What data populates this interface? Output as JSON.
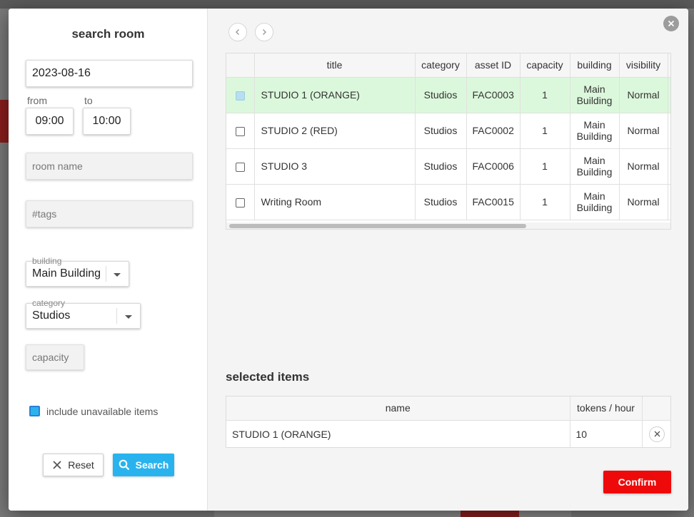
{
  "colors": {
    "accent_blue": "#29b3ee",
    "confirm_red": "#ee0a0a",
    "selected_row_green": "#dcf8dc"
  },
  "search_panel": {
    "title": "search room",
    "date": "2023-08-16",
    "from_label": "from",
    "to_label": "to",
    "from_time": "09:00",
    "to_time": "10:00",
    "room_name_placeholder": "room name",
    "tags_placeholder": "#tags",
    "building_label": "building",
    "building_value": "Main Building",
    "category_label": "category",
    "category_value": "Studios",
    "capacity_placeholder": "capacity",
    "include_unavailable_label": "include unavailable items",
    "include_unavailable_checked": true,
    "reset_label": "Reset",
    "search_label": "Search"
  },
  "results_table": {
    "columns": [
      "title",
      "category",
      "asset ID",
      "capacity",
      "building",
      "visibility"
    ],
    "rows": [
      {
        "title": "STUDIO 1 (ORANGE)",
        "category": "Studios",
        "asset_id": "FAC0003",
        "capacity": "1",
        "building": "Main Building",
        "visibility": "Normal",
        "selected": true
      },
      {
        "title": "STUDIO 2 (RED)",
        "category": "Studios",
        "asset_id": "FAC0002",
        "capacity": "1",
        "building": "Main Building",
        "visibility": "Normal",
        "selected": false
      },
      {
        "title": "STUDIO 3",
        "category": "Studios",
        "asset_id": "FAC0006",
        "capacity": "1",
        "building": "Main Building",
        "visibility": "Normal",
        "selected": false
      },
      {
        "title": "Writing Room",
        "category": "Studios",
        "asset_id": "FAC0015",
        "capacity": "1",
        "building": "Main Building",
        "visibility": "Normal",
        "selected": false
      }
    ]
  },
  "selected_items": {
    "title": "selected items",
    "columns": [
      "name",
      "tokens / hour"
    ],
    "rows": [
      {
        "name": "STUDIO 1 (ORANGE)",
        "tokens_per_hour": "10"
      }
    ]
  },
  "confirm_label": "Confirm"
}
